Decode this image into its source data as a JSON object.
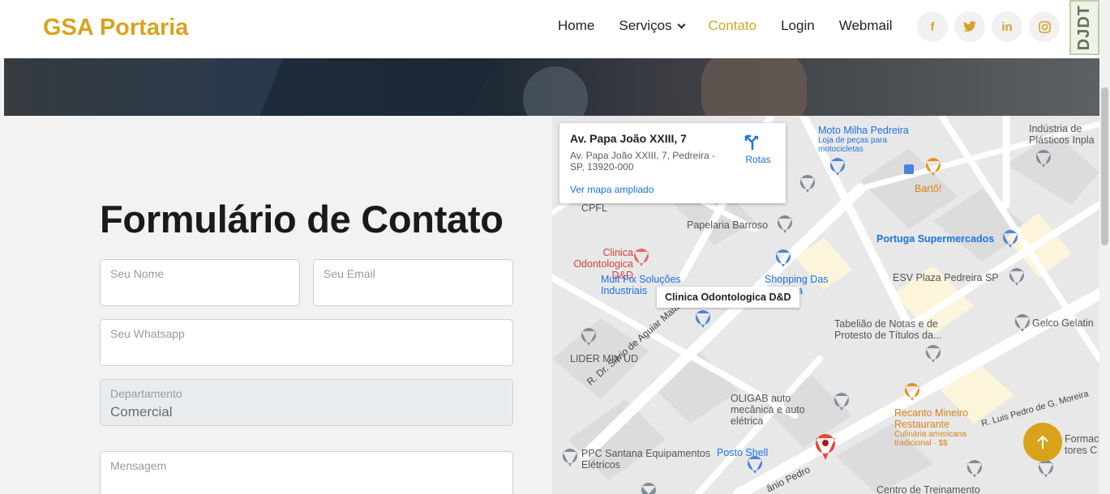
{
  "header": {
    "brand": "GSA Portaria",
    "nav": [
      {
        "label": "Home",
        "active": false
      },
      {
        "label": "Serviços",
        "active": false,
        "has_dropdown": true
      },
      {
        "label": "Contato",
        "active": true
      },
      {
        "label": "Login",
        "active": false
      },
      {
        "label": "Webmail",
        "active": false
      }
    ],
    "social_icons": [
      "facebook-icon",
      "twitter-icon",
      "linkedin-icon",
      "instagram-icon"
    ],
    "badge_text": "DJDT"
  },
  "form": {
    "title": "Formulário de Contato",
    "name_placeholder": "Seu Nome",
    "email_placeholder": "Seu Email",
    "whatsapp_placeholder": "Seu Whatsapp",
    "department_label": "Departamento",
    "department_value": "Comercial",
    "message_placeholder": "Mensagem"
  },
  "map": {
    "card_title": "Av. Papa João XXIII, 7",
    "card_address": "Av. Papa João XXIII, 7, Pedreira - SP, 13920-000",
    "card_link": "Ver mapa ampliado",
    "directions_label": "Rotas",
    "tooltip": "Clinica Odontologica D&D",
    "places": {
      "moto_milha": "Moto Milha Pedreira",
      "moto_sub": "Loja de peças para motocicletas",
      "industria": "Indústria de Plásticos Inpla",
      "barto": "Bartô!",
      "cpfl": "CPFL",
      "papelaria": "Papelaria Barroso",
      "portuga": "Portuga Supermercados",
      "clinica": "Clinica Odontologica D&D",
      "multfix": "Mult Fix Soluções Industriais",
      "shopping": "Shopping Das Pedreira",
      "esv": "ESV Plaza Pedreira SP",
      "tabeliao": "Tabelião de Notas e de Protesto de Títulos da...",
      "gelco": "Gelco Gelatin",
      "lider": "LIDER MIX UD",
      "oligab": "OLIGAB auto mecânica e auto elétrica",
      "recanto": "Recanto Mineiro Restaurante",
      "recanto_sub": "Culinária americana tradicional · $$",
      "ppc": "PPC Santana Equipamentos Elétricos",
      "posto": "Posto Shell",
      "centro": "Centro de Treinamento",
      "formacao": "Formac tores C"
    },
    "streets": {
      "silvio": "R. Dr. Silvio de Aguiar Maia",
      "luis": "R. Luis Pedro de G. Moreira",
      "pedro": "ânio Pedro"
    }
  },
  "colors": {
    "brand": "#dba21f",
    "nav_active": "#d7a62b",
    "map_blue": "#1a73e8"
  }
}
